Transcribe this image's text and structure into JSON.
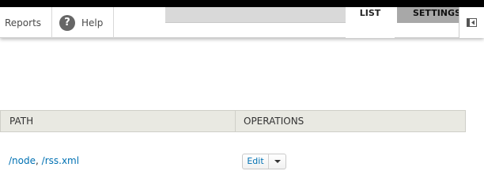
{
  "toolbar": {
    "reports_label": "Reports",
    "help_label": "Help",
    "help_icon_glyph": "?",
    "tabs": {
      "list": "LIST",
      "settings": "SETTINGS"
    }
  },
  "table": {
    "columns": [
      "PATH",
      "OPERATIONS"
    ],
    "rows": [
      {
        "paths": [
          "/node",
          "/rss.xml"
        ],
        "separator": ",",
        "edit_label": "Edit"
      }
    ]
  },
  "colors": {
    "link": "#0071b3",
    "header_bg": "#e9e9e2",
    "tab_active_bg": "#ffffff",
    "tab_inactive_bg": "#a8a8a8"
  },
  "icons": [
    "help-icon",
    "sidebar-toggle-icon",
    "dropdown-arrow-icon"
  ]
}
